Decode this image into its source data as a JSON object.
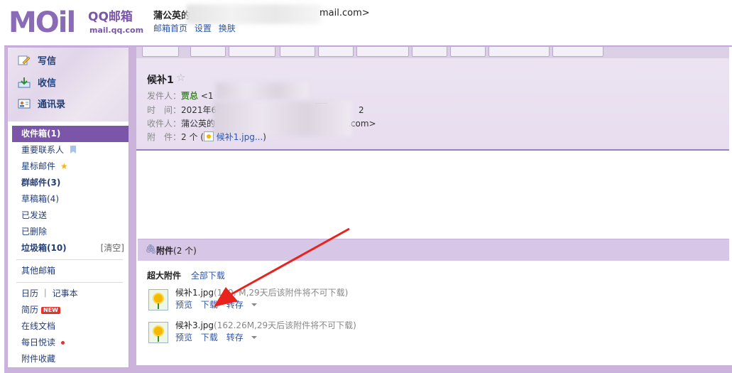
{
  "header": {
    "logo_m": "MOil",
    "logo_qq": "QQ邮箱",
    "logo_url": "mail.qq.com",
    "user_name": "蒲公英的",
    "user_email_suffix": "mail.com>",
    "links": [
      "邮箱首页",
      "设置",
      "换肤"
    ]
  },
  "sidebar": {
    "quick": [
      {
        "label": "写信",
        "icon": "pencil-icon"
      },
      {
        "label": "收信",
        "icon": "download-icon"
      },
      {
        "label": "通讯录",
        "icon": "contacts-icon"
      }
    ],
    "folders": [
      {
        "label": "收件箱(1)",
        "active": true
      },
      {
        "label": "重要联系人",
        "icon": "bookmark-icon"
      },
      {
        "label": "星标邮件",
        "icon": "star-icon"
      },
      {
        "label": "群邮件(3)",
        "bold": true
      },
      {
        "label": "草稿箱(4)"
      },
      {
        "label": "已发送"
      },
      {
        "label": "已删除"
      },
      {
        "label": "垃圾箱(10)",
        "bold": true,
        "extra": "[清空]"
      }
    ],
    "other": "其他邮箱",
    "apps": [
      {
        "label": "日历 ｜ 记事本"
      },
      {
        "label": "简历",
        "badge": "NEW"
      },
      {
        "label": "在线文档"
      },
      {
        "label": "每日悦读",
        "dot": true
      },
      {
        "label": "附件收藏"
      }
    ]
  },
  "mail": {
    "subject": "候补1",
    "sender_label": "发件人：",
    "sender_name": "贾总",
    "sender_addr_prefix": "<1",
    "time_label": "时　间：",
    "time_value": "2021年6",
    "time_tail": "2",
    "to_label": "收件人：",
    "to_value": "蒲公英的",
    "to_tail": "qq.com>",
    "att_label": "附　件：",
    "att_count": "2 个 (",
    "att_file": "候补1.jpg...",
    "att_close": ")"
  },
  "attachments": {
    "bar_title": "附件",
    "bar_count": "(2 个)",
    "super_label": "超大附件",
    "download_all": "全部下载",
    "items": [
      {
        "name": "候补1.jpg",
        "meta": "(160.  M,29天后该附件将不可下载)"
      },
      {
        "name": "候补3.jpg",
        "meta": "(162.26M,29天后该附件将不可下载)"
      }
    ],
    "ops": {
      "preview": "预览",
      "download": "下载",
      "save": "转存"
    }
  },
  "colors": {
    "brand_purple": "#7a55a8",
    "link_blue": "#2c55a8",
    "arrow_red": "#e8221c"
  }
}
